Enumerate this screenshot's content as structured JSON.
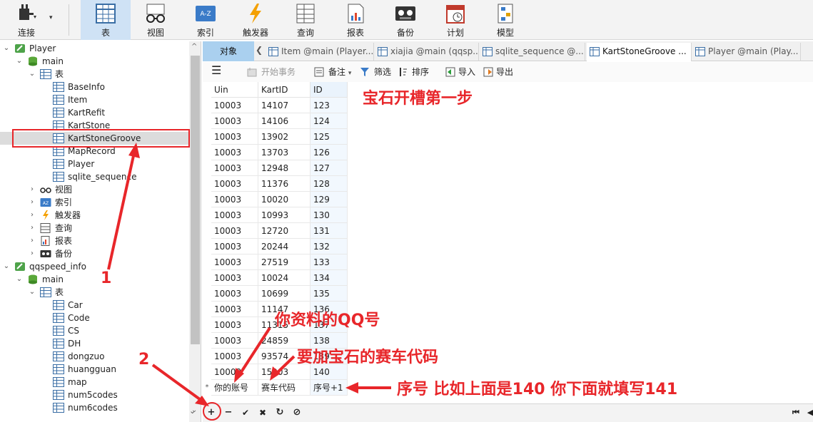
{
  "toolbar": {
    "buttons": [
      {
        "label": "连接"
      },
      {
        "label": "表"
      },
      {
        "label": "视图"
      },
      {
        "label": "索引"
      },
      {
        "label": "触发器"
      },
      {
        "label": "查询"
      },
      {
        "label": "报表"
      },
      {
        "label": "备份"
      },
      {
        "label": "计划"
      },
      {
        "label": "模型"
      }
    ],
    "index_icon_text": "A-Z"
  },
  "tree": {
    "db1": {
      "name": "Player",
      "schema": "main",
      "tables_label": "表",
      "tables": [
        "BaseInfo",
        "Item",
        "KartRefit",
        "KartStone",
        "KartStoneGroove",
        "MapRecord",
        "Player",
        "sqlite_sequence"
      ],
      "groups": [
        "视图",
        "索引",
        "触发器",
        "查询",
        "报表",
        "备份"
      ]
    },
    "db2": {
      "name": "qqspeed_info",
      "schema": "main",
      "tables_label": "表",
      "tables": [
        "Car",
        "Code",
        "CS",
        "DH",
        "dongzuo",
        "huangguan",
        "map",
        "num5codes",
        "num6codes"
      ]
    }
  },
  "tabs": {
    "objects_label": "对象",
    "items": [
      "Item @main (Player...",
      "xiajia @main (qqsp...",
      "sqlite_sequence @...",
      "KartStoneGroove ...",
      "Player @main (Play..."
    ]
  },
  "subbar": {
    "begin_tx": "开始事务",
    "note": "备注",
    "filter": "筛选",
    "sort": "排序",
    "import": "导入",
    "export": "导出"
  },
  "grid": {
    "columns": [
      "Uin",
      "KartID",
      "ID"
    ],
    "rows": [
      [
        "10003",
        "14107",
        "123"
      ],
      [
        "10003",
        "14106",
        "124"
      ],
      [
        "10003",
        "13902",
        "125"
      ],
      [
        "10003",
        "13703",
        "126"
      ],
      [
        "10003",
        "12948",
        "127"
      ],
      [
        "10003",
        "11376",
        "128"
      ],
      [
        "10003",
        "10020",
        "129"
      ],
      [
        "10003",
        "10993",
        "130"
      ],
      [
        "10003",
        "12720",
        "131"
      ],
      [
        "10003",
        "20244",
        "132"
      ],
      [
        "10003",
        "27519",
        "133"
      ],
      [
        "10003",
        "10024",
        "134"
      ],
      [
        "10003",
        "10699",
        "135"
      ],
      [
        "10003",
        "11147",
        "136"
      ],
      [
        "10003",
        "11315",
        "137"
      ],
      [
        "10003",
        "24859",
        "138"
      ],
      [
        "10003",
        "93574",
        "139"
      ],
      [
        "10003",
        "15203",
        "140"
      ]
    ],
    "new_row": {
      "marker": "*",
      "uin": "你的账号",
      "kart": "赛车代码",
      "id": "序号+1"
    }
  },
  "bottombar": {
    "add": "+",
    "delete": "−",
    "apply": "✔",
    "cancel": "✖",
    "refresh": "↻",
    "stop": "⊘"
  },
  "annotations": {
    "step_title": "宝石开槽第一步",
    "qq_note": "你资料的QQ号",
    "kart_note": "要加宝石的赛车代码",
    "id_note": "序号  比如上面是140  你下面就填写141",
    "num1": "1",
    "num2": "2"
  },
  "colors": {
    "annotation": "#e8262a",
    "selected_tab": "#aad0ef",
    "toolbar_active": "#cfe2f5"
  }
}
